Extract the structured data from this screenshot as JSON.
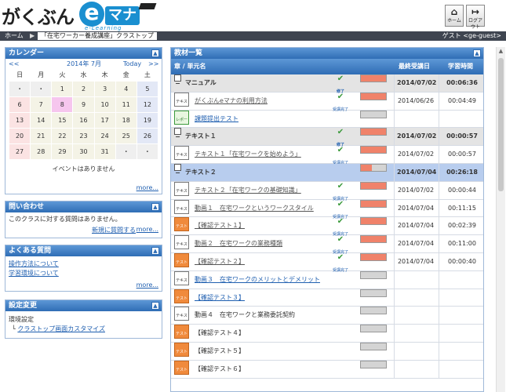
{
  "header": {
    "logo_text": "がくぶん",
    "logo_e": "e",
    "logo_mana": "マナ",
    "logo_sub": "e-Learning",
    "home_label": "ホーム",
    "logout_label": "ログアウト"
  },
  "nav": {
    "home": "ホーム",
    "breadcrumb": "「在宅ワーカー養成講座」クラストップ",
    "guest": "ゲスト <ge-guest>"
  },
  "calendar": {
    "title": "カレンダー",
    "prev": "<<",
    "month": "2014年 7月",
    "today": "Today",
    "next": ">>",
    "weekdays": [
      "日",
      "月",
      "火",
      "水",
      "木",
      "金",
      "土"
    ],
    "weeks": [
      [
        "・",
        "・",
        "1",
        "2",
        "3",
        "4",
        "5"
      ],
      [
        "6",
        "7",
        "8",
        "9",
        "10",
        "11",
        "12"
      ],
      [
        "13",
        "14",
        "15",
        "16",
        "17",
        "18",
        "19"
      ],
      [
        "20",
        "21",
        "22",
        "23",
        "24",
        "25",
        "26"
      ],
      [
        "27",
        "28",
        "29",
        "30",
        "31",
        "・",
        "・"
      ]
    ],
    "no_events": "イベントはありません",
    "more": "more..."
  },
  "inquiry": {
    "title": "問い合わせ",
    "text": "このクラスに対する質問はありません。",
    "new_question": "新規に質問する",
    "more": "more..."
  },
  "faq": {
    "title": "よくある質問",
    "items": [
      "操作方法について",
      "学習環境について"
    ],
    "more": "more..."
  },
  "settings": {
    "title": "設定変更",
    "env": "環境設定",
    "customize": "クラストップ画面カスタマイズ"
  },
  "materials": {
    "title": "教材一覧",
    "col_chapter": "章 / 単元名",
    "col_last": "最終受講日",
    "col_time": "学習時間",
    "done_label": "受講完了",
    "done_section": "修了",
    "rows": [
      {
        "kind": "sect",
        "name": "マニュアル",
        "done": "修了",
        "progress": "100%",
        "date": "2014/07/02",
        "time": "00:06:36"
      },
      {
        "kind": "item",
        "icon": "text",
        "name": "がくぶんeマナの利用方法",
        "done": "受講完了",
        "progress": "100%",
        "date": "2014/06/26",
        "time": "00:04:49"
      },
      {
        "kind": "item",
        "icon": "report",
        "name": "課題提出テスト",
        "done": "",
        "progress": "0%",
        "date": "",
        "time": ""
      },
      {
        "kind": "sect",
        "name": "テキスト１",
        "done": "修了",
        "progress": "100%",
        "date": "2014/07/02",
        "time": "00:00:57"
      },
      {
        "kind": "item",
        "icon": "text",
        "name": "テキスト１「在宅ワークを始めよう」",
        "done": "受講完了",
        "progress": "100%",
        "date": "2014/07/02",
        "time": "00:00:57"
      },
      {
        "kind": "hl",
        "name": "テキスト２",
        "done": "",
        "progress": "45%",
        "date": "2014/07/04",
        "time": "00:26:18"
      },
      {
        "kind": "item",
        "icon": "text",
        "name": "テキスト２「在宅ワークの基礎知識」",
        "done": "受講完了",
        "progress": "100%",
        "date": "2014/07/02",
        "time": "00:00:44"
      },
      {
        "kind": "item",
        "icon": "text",
        "name": "動画１　在宅ワークというワークスタイル",
        "done": "受講完了",
        "progress": "100%",
        "date": "2014/07/04",
        "time": "00:11:15"
      },
      {
        "kind": "item",
        "icon": "test",
        "name": "【確認テスト１】",
        "done": "受講完了",
        "progress": "100%",
        "date": "2014/07/04",
        "time": "00:02:39"
      },
      {
        "kind": "item",
        "icon": "text",
        "name": "動画２　在宅ワークの業務種類",
        "done": "受講完了",
        "progress": "100%",
        "date": "2014/07/04",
        "time": "00:11:00"
      },
      {
        "kind": "item",
        "icon": "test",
        "name": "【確認テスト２】",
        "done": "受講完了",
        "progress": "100%",
        "date": "2014/07/04",
        "time": "00:00:40"
      },
      {
        "kind": "item",
        "icon": "text",
        "name": "動画３　在宅ワークのメリットとデメリット",
        "done": "",
        "progress": "0%",
        "date": "",
        "time": "",
        "link": "blue"
      },
      {
        "kind": "item",
        "icon": "test",
        "name": "【確認テスト３】",
        "done": "",
        "progress": "0%",
        "date": "",
        "time": "",
        "link": "blue"
      },
      {
        "kind": "item",
        "icon": "text",
        "name": "動画４　在宅ワークと業務委託契約",
        "done": "",
        "progress": "0%",
        "date": "",
        "time": "",
        "link": "plain"
      },
      {
        "kind": "item",
        "icon": "test",
        "name": "【確認テスト４】",
        "done": "",
        "progress": "0%",
        "date": "",
        "time": "",
        "link": "plain"
      },
      {
        "kind": "item",
        "icon": "test",
        "name": "【確認テスト５】",
        "done": "",
        "progress": "0%",
        "date": "",
        "time": "",
        "link": "plain"
      },
      {
        "kind": "item",
        "icon": "test",
        "name": "【確認テスト６】",
        "done": "",
        "progress": "0%",
        "date": "",
        "time": "",
        "link": "plain"
      }
    ]
  },
  "icons": {
    "text_icon": "テキスト",
    "test_icon": "テスト",
    "report_icon": "レポート"
  },
  "colors": {
    "accent": "#2f6db5",
    "progress_fill": "#f0826a",
    "today_cell": "#f6c6ee"
  }
}
